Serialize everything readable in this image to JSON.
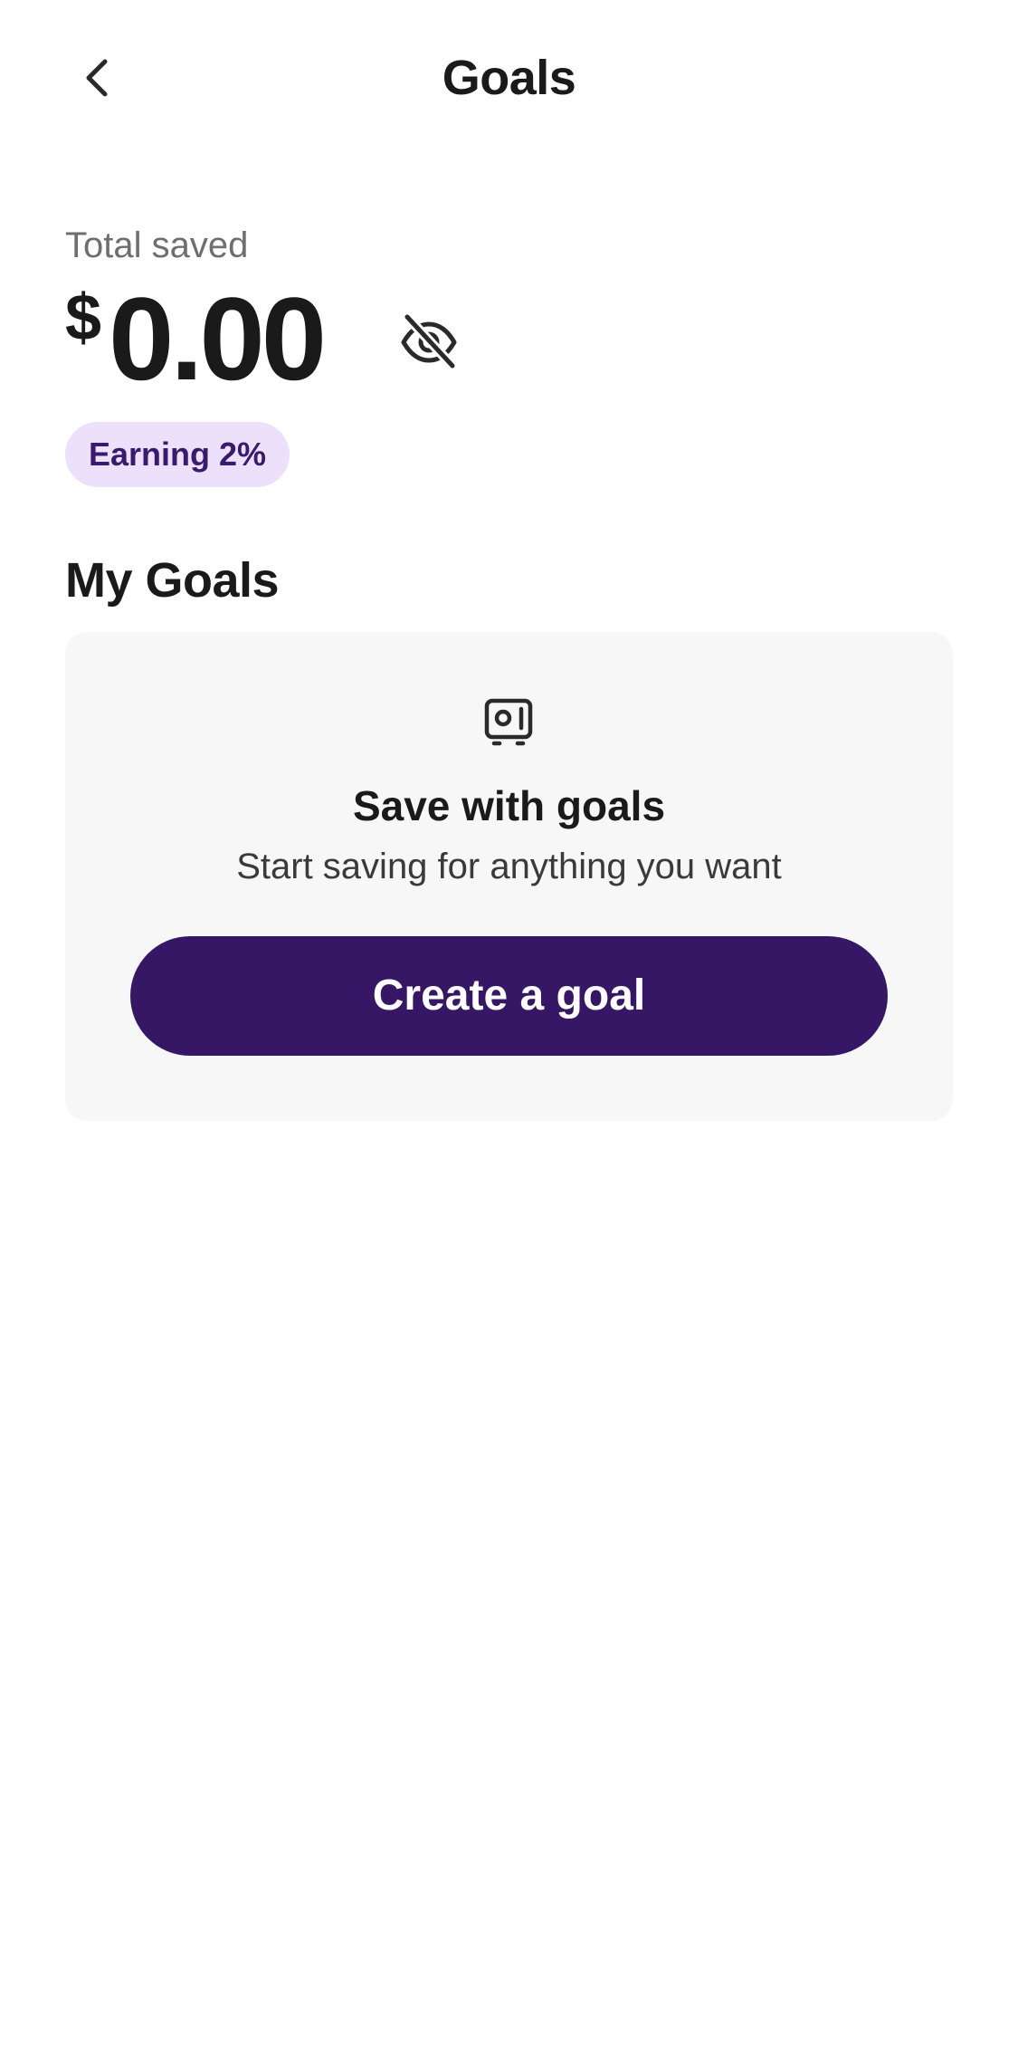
{
  "header": {
    "title": "Goals",
    "back_icon": "chevron-left-icon"
  },
  "summary": {
    "label": "Total saved",
    "currency_symbol": "$",
    "amount": "0.00",
    "visibility_icon": "eye-off-icon",
    "earning_badge": "Earning 2%"
  },
  "goals_section": {
    "title": "My Goals",
    "empty_state": {
      "icon": "safe-icon",
      "title": "Save with goals",
      "subtitle": "Start saving for anything you want",
      "button_label": "Create a goal"
    }
  },
  "colors": {
    "accent": "#361766",
    "badge_bg": "#ece0fb",
    "badge_text": "#3a1a6e",
    "card_bg": "#f7f7f7"
  }
}
